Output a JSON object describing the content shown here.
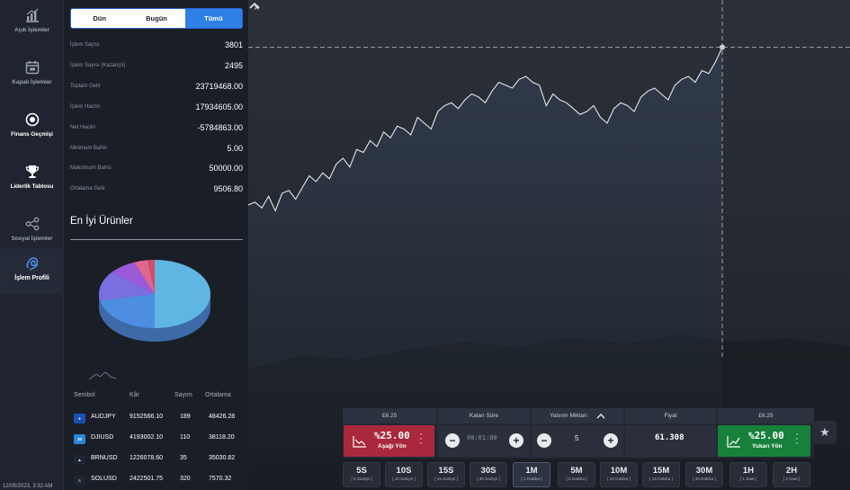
{
  "nav": {
    "items": [
      {
        "label": "Açık İşlemler",
        "icon": "chart-up-icon"
      },
      {
        "label": "Kapalı İşlemler",
        "icon": "calendar-icon"
      },
      {
        "label": "Finans Geçmişi",
        "icon": "history-icon"
      },
      {
        "label": "Liderlik Tablosu",
        "icon": "trophy-icon"
      },
      {
        "label": "Sosyal İşlemler",
        "icon": "share-icon"
      },
      {
        "label": "İşlem Profili",
        "icon": "profile-icon"
      }
    ],
    "active_index": 5,
    "datetime": "12/05/2023, 3:32 AM"
  },
  "panel": {
    "tabs": [
      "Dün",
      "Bugün",
      "Tümü"
    ],
    "active_tab": 2,
    "stats": [
      {
        "label": "İşlem Sayısı",
        "value": "3801"
      },
      {
        "label": "İşlem Sayısı (Kazançlı)",
        "value": "2495"
      },
      {
        "label": "Toplam Gelir",
        "value": "23719468.00"
      },
      {
        "label": "İşlem Hacmi",
        "value": "17934605.00"
      },
      {
        "label": "Net Hacim",
        "value": "-5784863.00"
      },
      {
        "label": "Minimum Bahis",
        "value": "5.00"
      },
      {
        "label": "Maksimum Bahis",
        "value": "50000.00"
      },
      {
        "label": "Ortalama Gelir",
        "value": "9506.80"
      }
    ],
    "best_title": "En İyi Ürünler",
    "pie_colors": [
      "#5fb6e3",
      "#4e8ee0",
      "#7a6fe0",
      "#9a5ad8",
      "#e2668f",
      "#d14f6a"
    ],
    "table": {
      "headers": [
        "Sembol",
        "Kâr",
        "Sayım",
        "Ortalama"
      ],
      "rows": [
        {
          "symbol": "AUDJPY",
          "profit": "9152566.10",
          "count": "189",
          "avg": "48426.28",
          "flag_color": "#1d4fb3",
          "flag_text": "●"
        },
        {
          "symbol": "DJIUSD",
          "profit": "4193002.10",
          "count": "110",
          "avg": "38118.20",
          "flag_color": "#2a86d9",
          "flag_text": "30"
        },
        {
          "symbol": "BRNUSD",
          "profit": "1226078.60",
          "count": "35",
          "avg": "35030.82",
          "flag_color": "#1e2633",
          "flag_text": "▲"
        },
        {
          "symbol": "SOLUSD",
          "profit": "2422501.75",
          "count": "320",
          "avg": "7570.32",
          "flag_color": "#1e2633",
          "flag_text": "≡"
        }
      ]
    }
  },
  "chart": {
    "line_color": "#e6e8ec",
    "crosshair_color": "#b9bec7",
    "close_glyph": "×",
    "series": [
      0.36,
      0.37,
      0.35,
      0.39,
      0.34,
      0.4,
      0.41,
      0.38,
      0.42,
      0.46,
      0.44,
      0.47,
      0.45,
      0.5,
      0.52,
      0.49,
      0.55,
      0.54,
      0.58,
      0.56,
      0.61,
      0.59,
      0.63,
      0.62,
      0.6,
      0.66,
      0.64,
      0.62,
      0.68,
      0.7,
      0.71,
      0.69,
      0.72,
      0.74,
      0.73,
      0.71,
      0.75,
      0.78,
      0.77,
      0.76,
      0.79,
      0.8,
      0.78,
      0.77,
      0.7,
      0.74,
      0.72,
      0.71,
      0.69,
      0.67,
      0.68,
      0.7,
      0.66,
      0.64,
      0.69,
      0.71,
      0.7,
      0.68,
      0.73,
      0.75,
      0.76,
      0.74,
      0.72,
      0.77,
      0.79,
      0.8,
      0.78,
      0.82,
      0.81,
      0.85,
      0.9
    ]
  },
  "trade": {
    "cols": [
      "£6.25",
      "Kalan Süre",
      "Yatırım Miktarı",
      "Fiyat",
      "£6.25"
    ],
    "down": {
      "pct": "%25.00",
      "label": "Aşağı Yön"
    },
    "up": {
      "pct": "%25.00",
      "label": "Yukarı Yön"
    },
    "timer": "00:01:00",
    "amount": "5",
    "price": "61.308",
    "minus": "−",
    "plus": "+",
    "star": "★"
  },
  "timeframes": [
    {
      "big": "5S",
      "small": "[ 5 Saniye ]"
    },
    {
      "big": "10S",
      "small": "[ 10 Saniye ]"
    },
    {
      "big": "15S",
      "small": "[ 15 Saniye ]"
    },
    {
      "big": "30S",
      "small": "[ 30 Saniye ]"
    },
    {
      "big": "1M",
      "small": "[ 1 Dakika ]"
    },
    {
      "big": "5M",
      "small": "[ 5 Dakika ]"
    },
    {
      "big": "10M",
      "small": "[ 10 Dakika ]"
    },
    {
      "big": "15M",
      "small": "[ 15 Dakika ]"
    },
    {
      "big": "30M",
      "small": "[ 30 Dakika ]"
    },
    {
      "big": "1H",
      "small": "[ 1 Saat ]"
    },
    {
      "big": "2H",
      "small": "[ 2 Saat ]"
    }
  ],
  "active_timeframe": 4
}
